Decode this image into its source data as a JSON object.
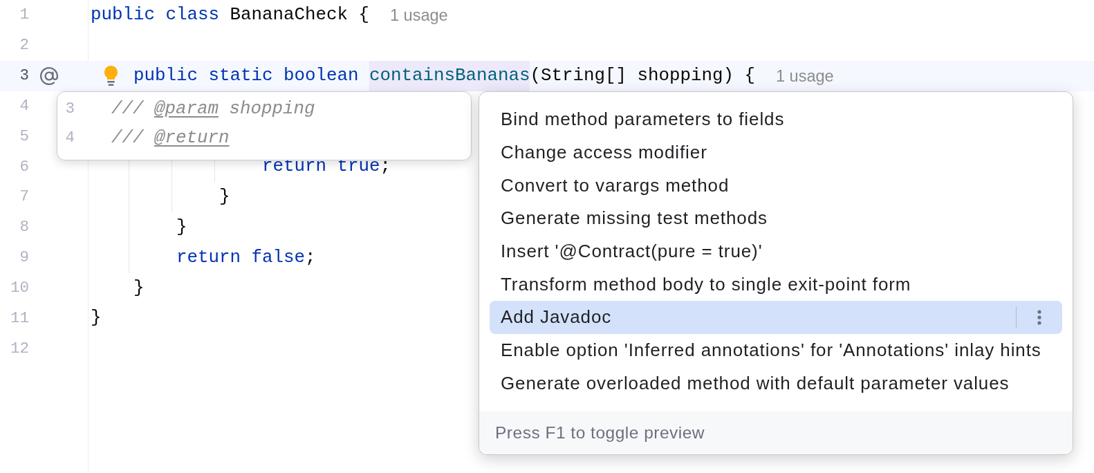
{
  "editor": {
    "lines": [
      {
        "number": "1",
        "current": false,
        "tokens": [
          {
            "kind": "keyword",
            "text": "public class"
          },
          {
            "kind": "plain",
            "text": " BananaCheck {"
          }
        ],
        "hint": "1 usage"
      },
      {
        "number": "2",
        "current": false
      },
      {
        "number": "3",
        "current": true,
        "gutter_marker": true,
        "bulb": true,
        "tokens": [
          {
            "kind": "keyword",
            "text": "    public static boolean "
          },
          {
            "kind": "method",
            "text": "containsBananas",
            "highlighted": true
          },
          {
            "kind": "plain",
            "text": "(String[] shopping) {"
          }
        ],
        "hint": "1 usage"
      },
      {
        "number": "4",
        "current": false
      },
      {
        "number": "5",
        "current": false
      },
      {
        "number": "6",
        "current": false,
        "tokens": [
          {
            "kind": "keyword",
            "text": "                return true"
          },
          {
            "kind": "plain",
            "text": ";"
          }
        ]
      },
      {
        "number": "7",
        "current": false,
        "tokens": [
          {
            "kind": "plain",
            "text": "            }"
          }
        ]
      },
      {
        "number": "8",
        "current": false,
        "tokens": [
          {
            "kind": "plain",
            "text": "        }"
          }
        ]
      },
      {
        "number": "9",
        "current": false,
        "tokens": [
          {
            "kind": "keyword",
            "text": "        return false"
          },
          {
            "kind": "plain",
            "text": ";"
          }
        ]
      },
      {
        "number": "10",
        "current": false,
        "tokens": [
          {
            "kind": "plain",
            "text": "    }"
          }
        ]
      },
      {
        "number": "11",
        "current": false,
        "tokens": [
          {
            "kind": "plain",
            "text": "}"
          }
        ]
      },
      {
        "number": "12",
        "current": false
      }
    ]
  },
  "preview": {
    "lines": [
      {
        "number": "3",
        "tokens": [
          {
            "kind": "comment",
            "text": "/// "
          },
          {
            "kind": "doc_tag",
            "text": "@param"
          },
          {
            "kind": "comment",
            "text": " shopping"
          }
        ]
      },
      {
        "number": "4",
        "tokens": [
          {
            "kind": "comment",
            "text": "/// "
          },
          {
            "kind": "doc_tag",
            "text": "@return"
          }
        ]
      }
    ]
  },
  "intentions": {
    "items": [
      {
        "label": "Bind method parameters to fields",
        "selected": false
      },
      {
        "label": "Change access modifier",
        "selected": false
      },
      {
        "label": "Convert to varargs method",
        "selected": false
      },
      {
        "label": "Generate missing test methods",
        "selected": false
      },
      {
        "label": "Insert '@Contract(pure = true)'",
        "selected": false
      },
      {
        "label": "Transform method body to single exit-point form",
        "selected": false
      },
      {
        "label": "Add Javadoc",
        "selected": true
      },
      {
        "label": "Enable option 'Inferred annotations' for 'Annotations' inlay hints",
        "selected": false
      },
      {
        "label": "Generate overloaded method with default parameter values",
        "selected": false
      }
    ],
    "footer": "Press F1 to toggle preview"
  }
}
